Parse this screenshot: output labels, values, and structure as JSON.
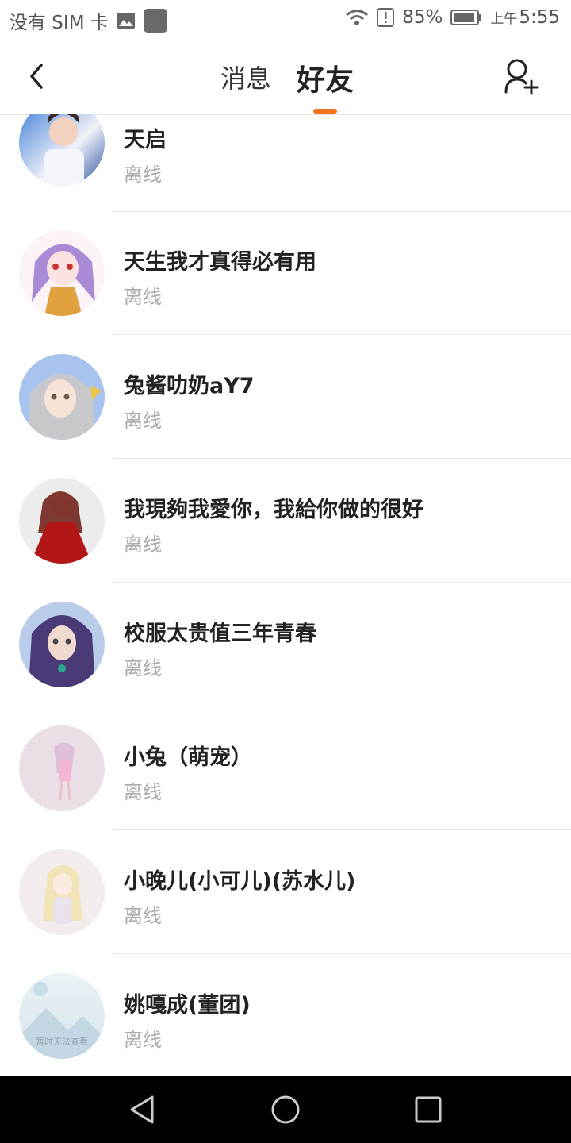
{
  "status_bar": {
    "carrier": "没有 SIM 卡",
    "battery": "85%",
    "time_prefix": "上午",
    "time": "5:55"
  },
  "header": {
    "tabs": [
      {
        "label": "消息"
      },
      {
        "label": "好友"
      }
    ],
    "active_tab": "好友"
  },
  "friends": [
    {
      "name": "天启",
      "status": "离线",
      "avatar_color": "#6a8fd6"
    },
    {
      "name": "天生我才真得必有用",
      "status": "离线",
      "avatar_color": "#b48fd6"
    },
    {
      "name": "兔酱叻奶aY7",
      "status": "离线",
      "avatar_color": "#8aaee0"
    },
    {
      "name": "我現夠我愛你，我給你做的很好",
      "status": "离线",
      "avatar_color": "#b51c1c"
    },
    {
      "name": "校服太贵值三年青春",
      "status": "离线",
      "avatar_color": "#5b4a8c"
    },
    {
      "name": "小兔（萌宠）",
      "status": "离线",
      "avatar_color": "#ecdde6"
    },
    {
      "name": "小晚儿(小可儿)(苏水儿)",
      "status": "离线",
      "avatar_color": "#f2e9e9"
    },
    {
      "name": "姚嘎成(董团)",
      "status": "离线",
      "avatar_color": "#dfeaf0",
      "avatar_placeholder": "暂时无法查看"
    }
  ],
  "colors": {
    "accent": "#f2731b",
    "offline_text": "#aaaaaa"
  },
  "icons": {
    "back": "back-arrow-icon",
    "add_friend": "add-user-icon",
    "nav_back": "nav-back-icon",
    "nav_home": "nav-home-icon",
    "nav_recents": "nav-recents-icon"
  }
}
